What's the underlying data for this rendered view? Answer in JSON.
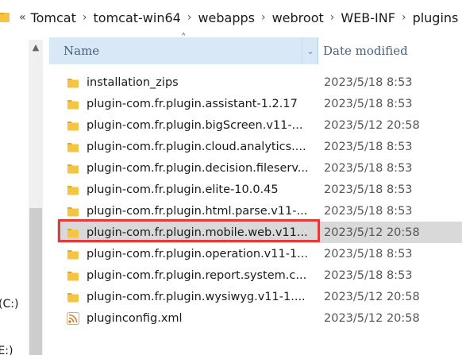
{
  "breadcrumb": {
    "overflow_glyph": "«",
    "separator": "›",
    "items": [
      "Tomcat",
      "tomcat-win64",
      "webapps",
      "webroot",
      "WEB-INF",
      "plugins"
    ]
  },
  "nav": {
    "drives": [
      "(C:)",
      "(E:)"
    ],
    "scroll_up_glyph": "▲"
  },
  "header": {
    "name_label": "Name",
    "date_label": "Date modified",
    "sort_glyph": "˄",
    "dropdown_glyph": "⌄"
  },
  "files": [
    {
      "name": "installation_zips",
      "date": "2023/5/18 8:53",
      "icon": "folder-icon"
    },
    {
      "name": "plugin-com.fr.plugin.assistant-1.2.17",
      "date": "2023/5/18 8:53",
      "icon": "folder-icon"
    },
    {
      "name": "plugin-com.fr.plugin.bigScreen.v11-...",
      "date": "2023/5/12 20:58",
      "icon": "folder-icon"
    },
    {
      "name": "plugin-com.fr.plugin.cloud.analytics....",
      "date": "2023/5/18 8:53",
      "icon": "folder-icon"
    },
    {
      "name": "plugin-com.fr.plugin.decision.fileserv...",
      "date": "2023/5/18 8:53",
      "icon": "folder-icon"
    },
    {
      "name": "plugin-com.fr.plugin.elite-10.0.45",
      "date": "2023/5/18 8:53",
      "icon": "folder-icon"
    },
    {
      "name": "plugin-com.fr.plugin.html.parse.v11-...",
      "date": "2023/5/18 8:53",
      "icon": "folder-icon"
    },
    {
      "name": "plugin-com.fr.plugin.mobile.web.v11...",
      "date": "2023/5/12 20:58",
      "icon": "folder-icon",
      "selected": true
    },
    {
      "name": "plugin-com.fr.plugin.operation.v11-1...",
      "date": "2023/5/18 8:53",
      "icon": "folder-icon"
    },
    {
      "name": "plugin-com.fr.plugin.report.system.c...",
      "date": "2023/5/18 8:53",
      "icon": "folder-icon"
    },
    {
      "name": "plugin-com.fr.plugin.wysiwyg.v11-1....",
      "date": "2023/5/12 20:58",
      "icon": "folder-icon"
    },
    {
      "name": "pluginconfig.xml",
      "date": "2023/5/12 20:58",
      "icon": "xml-feed-icon"
    }
  ],
  "colors": {
    "folder": "#f5c443",
    "folder_dark": "#e0a92a",
    "highlight": "#e03c3c",
    "selected_row": "#d9d9d9",
    "header_bg": "#d9e8f7"
  }
}
